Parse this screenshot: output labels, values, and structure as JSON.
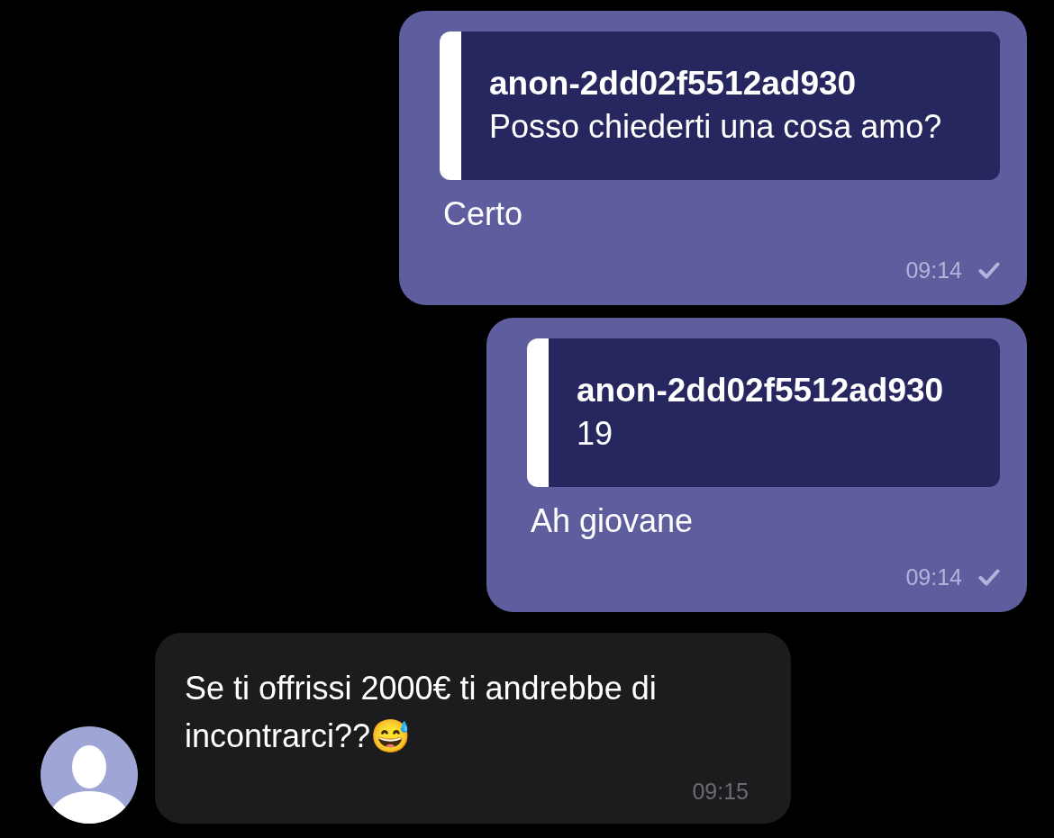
{
  "messages": [
    {
      "kind": "outgoing",
      "reply_to": {
        "author": "anon-2dd02f5512ad930",
        "text": "Posso chiederti una cosa amo?"
      },
      "text": "Certo",
      "time": "09:14",
      "sent": true
    },
    {
      "kind": "outgoing",
      "reply_to": {
        "author": "anon-2dd02f5512ad930",
        "text": "19"
      },
      "text": "Ah giovane",
      "time": "09:14",
      "sent": true
    },
    {
      "kind": "incoming",
      "text": "Se ti offrissi 2000€ ti andrebbe di incontrarci??😅",
      "time": "09:15",
      "sent": false
    }
  ]
}
